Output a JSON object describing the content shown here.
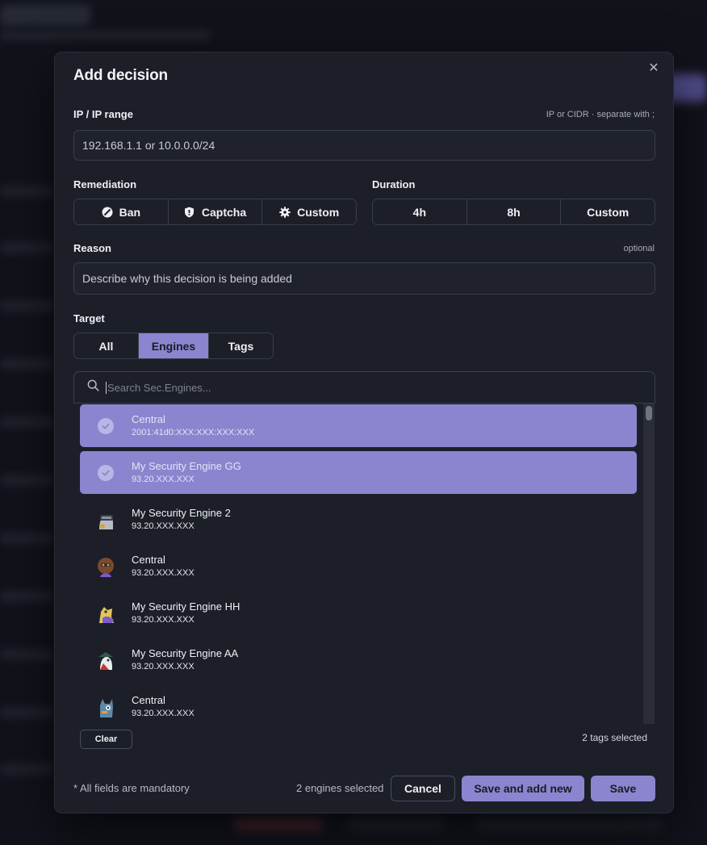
{
  "modal": {
    "title": "Add decision",
    "close_icon": "close-icon"
  },
  "ip": {
    "label": "IP / IP range",
    "hint": "IP or CIDR · separate with ;",
    "placeholder": "192.168.1.1 or 10.0.0.0/24"
  },
  "remediation": {
    "label": "Remediation",
    "options": [
      {
        "label": "Ban",
        "icon": "ban-icon",
        "active": false
      },
      {
        "label": "Captcha",
        "icon": "shield-icon",
        "active": false
      },
      {
        "label": "Custom",
        "icon": "gear-icon",
        "active": false
      }
    ]
  },
  "duration": {
    "label": "Duration",
    "options": [
      {
        "label": "4h",
        "active": false
      },
      {
        "label": "8h",
        "active": false
      },
      {
        "label": "Custom",
        "active": false
      }
    ]
  },
  "reason": {
    "label": "Reason",
    "hint": "optional",
    "placeholder": "Describe why this decision is being added"
  },
  "target": {
    "label": "Target",
    "options": [
      {
        "label": "All",
        "active": false
      },
      {
        "label": "Engines",
        "active": true
      },
      {
        "label": "Tags",
        "active": false
      }
    ],
    "search_placeholder": "Search Sec.Engines...",
    "engines": [
      {
        "name": "Central",
        "ip": "2001:41d0:XXX:XXX:XXX:XXX",
        "selected": true
      },
      {
        "name": "My Security Engine GG",
        "ip": "93.20.XXX.XXX",
        "selected": true
      },
      {
        "name": "My Security Engine 2",
        "ip": "93.20.XXX.XXX",
        "selected": false
      },
      {
        "name": "Central",
        "ip": "93.20.XXX.XXX",
        "selected": false
      },
      {
        "name": "My Security Engine HH",
        "ip": "93.20.XXX.XXX",
        "selected": false
      },
      {
        "name": "My Security Engine AA",
        "ip": "93.20.XXX.XXX",
        "selected": false
      },
      {
        "name": "Central",
        "ip": "93.20.XXX.XXX",
        "selected": false
      }
    ],
    "clear_label": "Clear",
    "tags_selected": "2 tags selected"
  },
  "footer": {
    "note": "* All fields are mandatory",
    "engines_selected": "2 engines selected",
    "cancel_label": "Cancel",
    "save_new_label": "Save and add new",
    "save_label": "Save"
  },
  "colors": {
    "accent": "#8b85cf",
    "surface": "#1c1f28",
    "border": "#3a3e4b"
  }
}
